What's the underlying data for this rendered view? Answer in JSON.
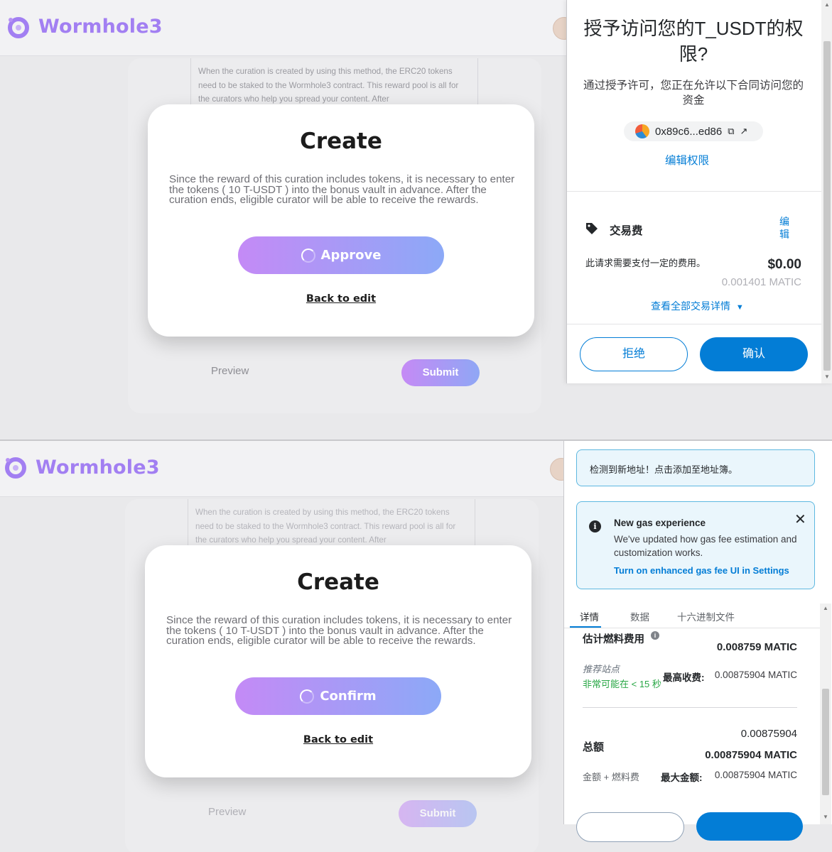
{
  "app": {
    "name": "Wormhole3",
    "bg_text": "When the curation is created by using this method, the ERC20 tokens need to be staked to the Wormhole3 contract. This reward pool is all for the curators who help you spread your content. After",
    "preview_label": "Preview",
    "submit_label": "Submit",
    "brand_color": "#a27ff2"
  },
  "modal": {
    "title": "Create",
    "body": "Since the reward of this curation includes tokens, it is necessary to enter the tokens ( 10 T-USDT ) into the bonus vault in advance. After the curation ends, eligible curator will be able to receive the rewards.",
    "approve_label": "Approve",
    "confirm_label": "Confirm",
    "back_label": "Back to edit"
  },
  "approval": {
    "title": "授予访问您的T_USDT的权限?",
    "subtitle": "通过授予许可，您正在允许以下合同访问您的资金",
    "address": "0x89c6...ed86",
    "edit_permission": "编辑权限",
    "fee_label": "交易费",
    "fee_edit": "编辑",
    "fee_desc": "此请求需要支付一定的费用。",
    "fee_usd": "$0.00",
    "fee_matic": "0.001401 MATIC",
    "view_details": "查看全部交易详情",
    "reject_label": "拒绝",
    "confirm_label": "确认",
    "accent_color": "#037dd6"
  },
  "confirmation": {
    "new_address_notice": "检测到新地址！点击添加至地址簿。",
    "gas_title": "New gas experience",
    "gas_body": "We've updated how gas fee estimation and customization works.",
    "gas_link": "Turn on enhanced gas fee UI in Settings",
    "tabs": [
      "详情",
      "数据",
      "十六进制文件"
    ],
    "est_gas_label": "估计燃料费用",
    "est_gas_value": "0.008759 MATIC",
    "recommended_site": "推荐站点",
    "likely_time": "非常可能在 < 15 秒",
    "max_fee_label": "最高收费:",
    "max_fee_value": "0.00875904 MATIC",
    "total_small": "0.00875904",
    "total_label": "总额",
    "total_value": "0.00875904 MATIC",
    "amount_gas_label": "金额 + 燃料费",
    "max_amount_label": "最大金额:",
    "max_amount_value": "0.00875904 MATIC"
  }
}
